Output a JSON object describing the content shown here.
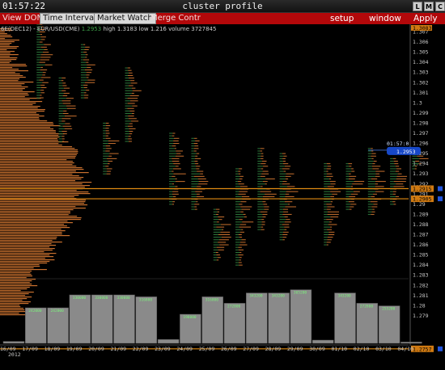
{
  "window": {
    "clock": "01:57:22",
    "title": "cluster profile",
    "buttons": [
      "L",
      "M",
      "C"
    ]
  },
  "menu": {
    "items": [
      {
        "label": "View DOM",
        "active": false
      },
      {
        "label": "Time Interval",
        "active": true
      },
      {
        "label": "Market Watch",
        "active": true
      },
      {
        "label": "Merge Contr",
        "active": false
      }
    ],
    "right_items": [
      "setup",
      "window",
      "Apply"
    ]
  },
  "info": {
    "instrument": "6E(DEC12) - EUR/USD(CME)",
    "last": "1.2953",
    "high": "high 1.3183",
    "low": "low 1.216",
    "volume": "volume 3727845"
  },
  "colors": {
    "background": "#000000",
    "menu_bar": "#b3080a",
    "sell_bars": "#c8702e",
    "buy_bars": "#2d7a3c",
    "highlight_line": "#e08a12",
    "current_price_tag": "#1748c8",
    "volume_bar": "#8a8a8a",
    "volume_text": "#7cf17c"
  },
  "price_axis": {
    "labels": [
      "1.307",
      "1.306",
      "1.305",
      "1.304",
      "1.303",
      "1.302",
      "1.301",
      "1.3",
      "1.299",
      "1.298",
      "1.297",
      "1.296",
      "1.295",
      "1.294",
      "1.293",
      "1.292",
      "1.291",
      "1.29",
      "1.289",
      "1.288",
      "1.287",
      "1.286",
      "1.285",
      "1.284",
      "1.283",
      "1.282",
      "1.281",
      "1.28",
      "1.279"
    ],
    "top_value": "1.3083",
    "current_time_tag": "01:57:0",
    "current_price_tag": "1.2953",
    "level_tags": [
      {
        "price": 1.2915,
        "label": "1.2915"
      },
      {
        "price": 1.2905,
        "label": "1.2905"
      },
      {
        "price": 1.2757,
        "label": "1.2757"
      }
    ]
  },
  "date_axis": {
    "labels": [
      "16/09",
      "17/09",
      "18/09",
      "19/09",
      "20/09",
      "21/09",
      "22/09",
      "23/09",
      "24/09",
      "25/09",
      "26/09",
      "27/09",
      "28/09",
      "29/09",
      "30/09",
      "01/10",
      "02/10",
      "03/10",
      "04/10"
    ],
    "year": "2012"
  },
  "chart_data": {
    "type": "bar",
    "description_free": true,
    "categories": [
      "16/09",
      "17/09",
      "18/09",
      "19/09",
      "20/09",
      "21/09",
      "22/09",
      "23/09",
      "24/09",
      "25/09",
      "26/09",
      "27/09",
      "28/09",
      "29/09",
      "30/09",
      "01/10",
      "02/10",
      "03/10",
      "04/10"
    ],
    "volume_relative": [
      0.03,
      0.55,
      0.55,
      0.75,
      0.75,
      0.75,
      0.72,
      0.06,
      0.45,
      0.72,
      0.62,
      0.78,
      0.78,
      0.83,
      0.05,
      0.78,
      0.62,
      0.58,
      0.02
    ],
    "profiles": [
      {
        "date": "17/09",
        "low": 1.3005,
        "high": 1.3083
      },
      {
        "date": "18/09",
        "low": 1.2962,
        "high": 1.3025
      },
      {
        "date": "19/09",
        "low": 1.3005,
        "high": 1.3058
      },
      {
        "date": "20/09",
        "low": 1.293,
        "high": 1.298
      },
      {
        "date": "21/09",
        "low": 1.2962,
        "high": 1.3035
      },
      {
        "date": "23/09",
        "low": 1.29,
        "high": 1.2972
      },
      {
        "date": "24/09",
        "low": 1.2895,
        "high": 1.2965
      },
      {
        "date": "25/09",
        "low": 1.2845,
        "high": 1.2895
      },
      {
        "date": "26/09",
        "low": 1.284,
        "high": 1.2935
      },
      {
        "date": "27/09",
        "low": 1.2875,
        "high": 1.2955
      },
      {
        "date": "28/09",
        "low": 1.2865,
        "high": 1.295
      },
      {
        "date": "30/09",
        "low": 1.286,
        "high": 1.294
      },
      {
        "date": "01/10",
        "low": 1.2895,
        "high": 1.2942
      },
      {
        "date": "02/10",
        "low": 1.289,
        "high": 1.2955
      },
      {
        "date": "03/10",
        "low": 1.29,
        "high": 1.2945
      },
      {
        "date": "04/10",
        "low": 1.2935,
        "high": 1.2953
      }
    ],
    "ylim": [
      1.2775,
      1.3083
    ]
  }
}
